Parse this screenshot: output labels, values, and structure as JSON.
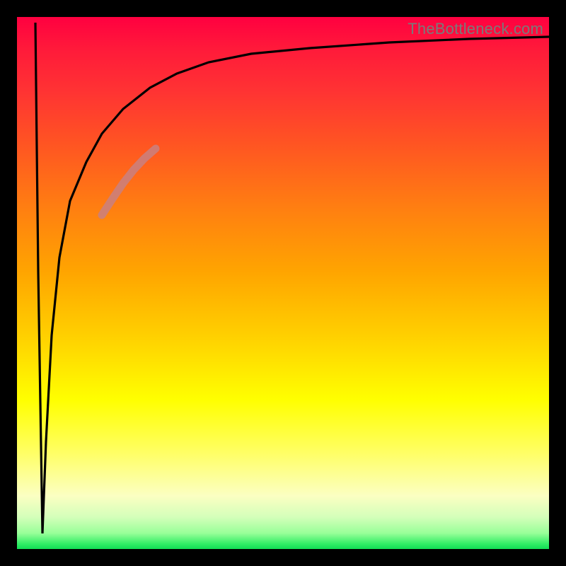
{
  "watermark": "TheBottleneck.com",
  "chart_data": {
    "type": "line",
    "title": "",
    "xlabel": "",
    "ylabel": "",
    "xlim": [
      0,
      100
    ],
    "ylim": [
      0,
      100
    ],
    "grid": false,
    "legend": false,
    "note": "No axis ticks or numeric labels are rendered; values below are estimated from pixel positions with y-up.",
    "series": [
      {
        "name": "main-curve",
        "color": "#000000",
        "x": [
          3.5,
          4.0,
          4.8,
          5.5,
          6.5,
          8.0,
          10.0,
          13.0,
          16.0,
          20.0,
          25.0,
          30.0,
          36.0,
          44.0,
          55.0,
          70.0,
          85.0,
          100.0
        ],
        "y": [
          98.0,
          50.0,
          3.0,
          20.0,
          40.0,
          55.0,
          65.0,
          73.0,
          78.0,
          83.0,
          87.0,
          89.5,
          91.5,
          93.0,
          94.2,
          95.2,
          95.8,
          96.2
        ]
      },
      {
        "name": "highlight-segment",
        "color": "#c98080",
        "x": [
          16.0,
          18.0,
          20.0,
          22.0,
          24.0,
          26.0
        ],
        "y": [
          63.0,
          66.0,
          69.0,
          71.5,
          73.5,
          75.0
        ]
      }
    ],
    "gradient_stops": [
      {
        "pos": 0.0,
        "color": "#ff0040"
      },
      {
        "pos": 0.5,
        "color": "#ffa500"
      },
      {
        "pos": 0.75,
        "color": "#ffff00"
      },
      {
        "pos": 0.97,
        "color": "#99ff99"
      },
      {
        "pos": 1.0,
        "color": "#11dd55"
      }
    ]
  }
}
